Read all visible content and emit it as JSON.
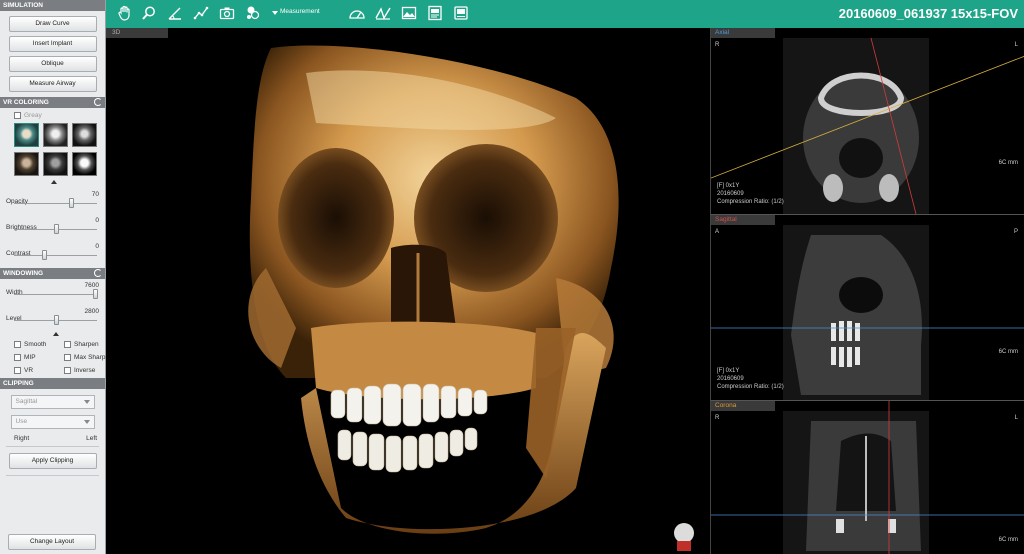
{
  "colors": {
    "toolbar_bg": "#1ea488",
    "sidebar_bg": "#e9ebec",
    "section_header_bg": "#7a7e82",
    "axial_label": "#4e9ad6",
    "sagittal_label": "#d05050",
    "coronal_label": "#d89a3a",
    "guide_blue": "#4a8ed8",
    "guide_red": "#d23a3a",
    "guide_yellow": "#d8b040"
  },
  "toolbar": {
    "icons": [
      "hand-icon",
      "zoom-icon",
      "angle-icon",
      "polyline-icon",
      "camera-icon",
      "paint-icon",
      "protractor-icon",
      "angle-measure-icon",
      "image-icon",
      "report-icon",
      "export-icon"
    ],
    "measurement_label": "Measurement",
    "title": "20160609_061937 15x15-FOV"
  },
  "sidebar": {
    "simulation": {
      "header": "SIMULATION",
      "buttons": [
        "Draw Curve",
        "Insert Implant",
        "Oblique",
        "Measure Airway"
      ]
    },
    "vr_coloring": {
      "header": "VR COLORING",
      "grey_label": "Greay",
      "presets": [
        "preset-1",
        "preset-2",
        "preset-3",
        "preset-4",
        "preset-5",
        "preset-6"
      ],
      "sliders": [
        {
          "label": "Opacity",
          "value": "70",
          "level": 0.7
        },
        {
          "label": "Brightness",
          "value": "0",
          "level": 0.5
        },
        {
          "label": "Contrast",
          "value": "0",
          "level": 0.35
        }
      ]
    },
    "windowing": {
      "header": "WINDOWING",
      "sliders": [
        {
          "label": "Width",
          "value": "7600",
          "level": 1.0
        },
        {
          "label": "Level",
          "value": "2800",
          "level": 0.5
        }
      ],
      "options": [
        "Smooth",
        "Sharpen",
        "MIP",
        "Max Sharp...",
        "VR",
        "Inverse"
      ]
    },
    "clipping": {
      "header": "CLIPPING",
      "select1": "Sagittal",
      "select2": "Use",
      "right_label": "Right",
      "left_label": "Left",
      "apply_label": "Apply Clipping"
    },
    "change_layout_label": "Change Layout"
  },
  "view3d": {
    "tab_label": "3D"
  },
  "panes": {
    "axial": {
      "tab": "Axial",
      "left_letter": "R",
      "right_letter": "L",
      "info": [
        "[F] 0x1Y",
        "20160609",
        "Compression Ratio: (1/2)"
      ],
      "scale": "6C mm"
    },
    "sagittal": {
      "tab": "Sagittal",
      "left_letter": "A",
      "right_letter": "P",
      "info": [
        "[F] 0x1Y",
        "20160609",
        "Compression Ratio: (1/2)"
      ],
      "scale": "6C mm"
    },
    "coronal": {
      "tab": "Corona",
      "left_letter": "R",
      "right_letter": "L",
      "scale": "6C mm"
    }
  }
}
